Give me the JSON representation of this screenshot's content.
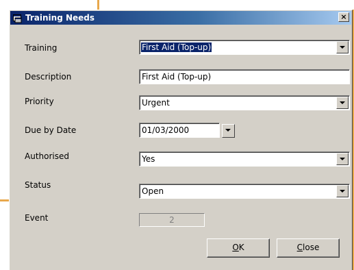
{
  "window": {
    "title": "Training Needs",
    "close_glyph": "×"
  },
  "form": {
    "training": {
      "label": "Training",
      "value": "First Aid (Top-up)"
    },
    "description": {
      "label": "Description",
      "value": "First Aid (Top-up)"
    },
    "priority": {
      "label": "Priority",
      "value": "Urgent"
    },
    "due_date": {
      "label": "Due by Date",
      "value": "01/03/2000"
    },
    "authorised": {
      "label": "Authorised",
      "value": "Yes"
    },
    "status": {
      "label": "Status",
      "value": "Open"
    },
    "event": {
      "label": "Event",
      "value": "2"
    }
  },
  "buttons": {
    "ok": {
      "mnemonic": "O",
      "rest": "K"
    },
    "close": {
      "mnemonic": "C",
      "rest": "lose"
    }
  },
  "colors": {
    "accent_border": "#e8a84c",
    "title_bar": "#0a246a",
    "face": "#d4d0c8"
  },
  "icons": {
    "title": "window-app-icon",
    "dropdown": "chevron-down-icon"
  }
}
